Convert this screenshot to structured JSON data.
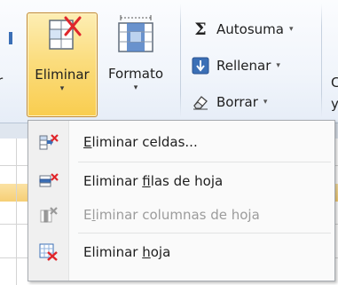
{
  "ribbon": {
    "left_edge_text": "r",
    "eliminar": {
      "label": "Eliminar",
      "icon": "delete-cells-icon"
    },
    "formato": {
      "label": "Formato",
      "icon": "format-cells-icon"
    },
    "autosuma": {
      "label": "Autosuma",
      "icon": "sigma-icon",
      "glyph": "Σ"
    },
    "rellenar": {
      "label": "Rellenar",
      "icon": "fill-down-icon"
    },
    "borrar": {
      "label": "Borrar",
      "icon": "eraser-icon"
    },
    "right_edge_text_1": "C",
    "right_edge_text_2": "y",
    "dropdown_glyph": "▾"
  },
  "menu": {
    "items": [
      {
        "prefix": "",
        "underlined": "E",
        "rest": "liminar celdas...",
        "enabled": true,
        "icon": "delete-cells-icon"
      },
      {
        "prefix": "Eliminar ",
        "underlined": "f",
        "rest": "ilas de hoja",
        "enabled": true,
        "icon": "delete-rows-icon"
      },
      {
        "prefix": "E",
        "underlined": "l",
        "rest": "iminar columnas de hoja",
        "enabled": false,
        "icon": "delete-columns-icon"
      },
      {
        "prefix": "Eliminar ",
        "underlined": "h",
        "rest": "oja",
        "enabled": true,
        "icon": "delete-sheet-icon"
      }
    ]
  },
  "colors": {
    "accent_red": "#e0262b",
    "accent_blue": "#3b6fb6",
    "highlight_orange": "#f9cd4f"
  }
}
